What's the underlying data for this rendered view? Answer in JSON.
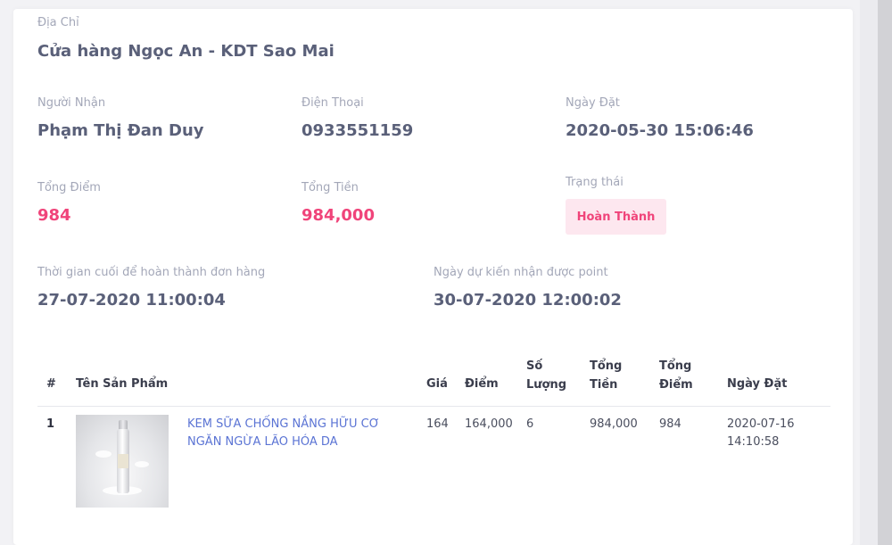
{
  "address": {
    "label": "Địa Chỉ",
    "value": "Cửa hàng Ngọc An - KDT Sao Mai"
  },
  "order_info": {
    "recipient_label": "Người Nhận",
    "recipient_value": "Phạm Thị Đan Duy",
    "phone_label": "Điện Thoại",
    "phone_value": "0933551159",
    "order_date_label": "Ngày Đặt",
    "order_date_value": "2020-05-30 15:06:46",
    "total_points_label": "Tổng Điểm",
    "total_points_value": "984",
    "total_money_label": "Tổng Tiền",
    "total_money_value": "984,000",
    "status_label": "Trạng thái",
    "status_value": "Hoàn Thành",
    "deadline_label": "Thời gian cuối để hoàn thành đơn hàng",
    "deadline_value": "27-07-2020 11:00:04",
    "expected_points_label": "Ngày dự kiến nhận được point",
    "expected_points_value": "30-07-2020 12:00:02"
  },
  "table": {
    "headers": {
      "index": "#",
      "product": "Tên Sản Phẩm",
      "price": "Giá",
      "points": "Điểm",
      "quantity_1": "Số",
      "quantity_2": "Lượng",
      "total_money_1": "Tổng",
      "total_money_2": "Tiền",
      "total_points_1": "Tổng",
      "total_points_2": "Điểm",
      "order_date": "Ngày Đặt"
    },
    "rows": [
      {
        "index": "1",
        "product_line1": "KEM SỮA CHỐNG NẮNG HỮU CƠ",
        "product_line2": "NGĂN NGỪA LÃO HÓA DA",
        "price": "164",
        "points": "164,000",
        "quantity": "6",
        "total_money": "984,000",
        "total_points": "984",
        "date_line1": "2020-07-16",
        "date_line2": "14:10:58"
      }
    ]
  },
  "colors": {
    "accent_pink": "#f0447a",
    "link_blue": "#5b74d4",
    "value_text": "#5a6079",
    "label_text": "#a3a7b8"
  }
}
